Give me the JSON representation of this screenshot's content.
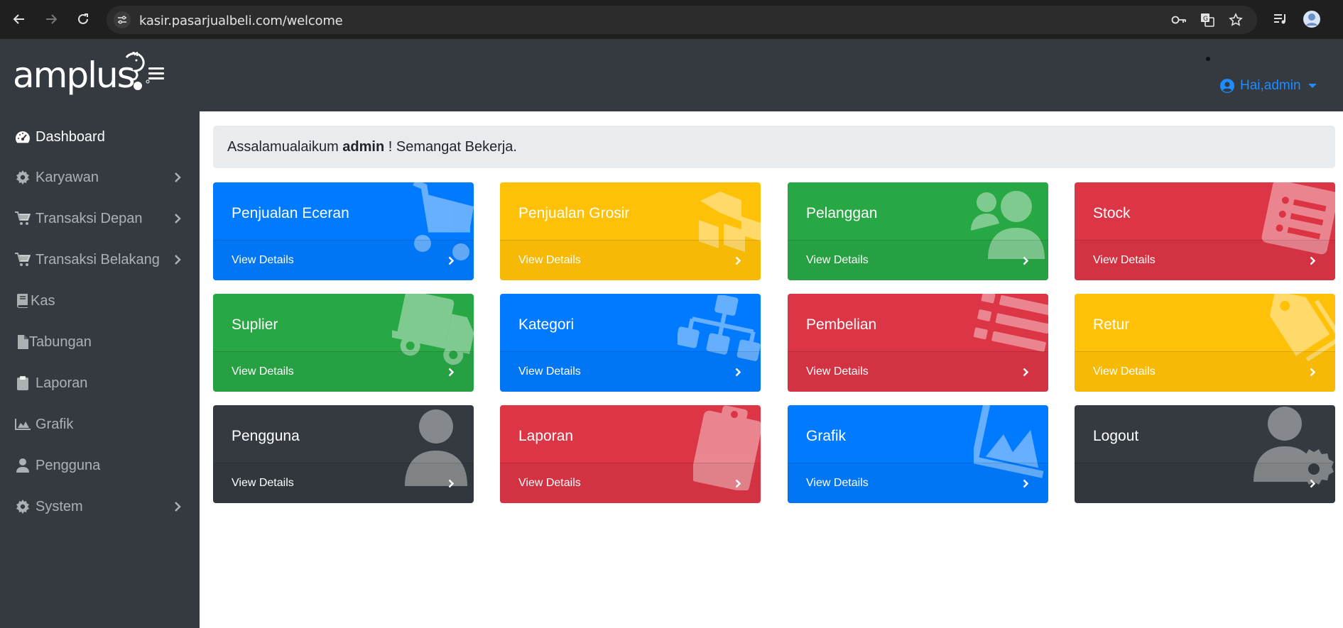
{
  "browser": {
    "url": "kasir.pasarjualbeli.com/welcome",
    "icons": [
      "back-icon",
      "forward-icon",
      "reload-icon",
      "site-settings-icon",
      "password-key-icon",
      "translate-icon",
      "bookmark-star-icon",
      "media-playlist-icon",
      "profile-avatar-icon"
    ]
  },
  "header": {
    "logo_text": "amplus",
    "user_menu_label": "Hai,admin"
  },
  "sidebar": {
    "items": [
      {
        "label": "Dashboard",
        "icon": "tachometer-icon",
        "has_submenu": false,
        "active": true
      },
      {
        "label": "Karyawan",
        "icon": "gear-icon",
        "has_submenu": true,
        "active": false
      },
      {
        "label": "Transaksi Depan",
        "icon": "cart-icon",
        "has_submenu": true,
        "active": false
      },
      {
        "label": "Transaksi Belakang",
        "icon": "cart-icon",
        "has_submenu": true,
        "active": false
      },
      {
        "label": "Kas",
        "icon": "book-icon",
        "has_submenu": false,
        "active": false
      },
      {
        "label": "Tabungan",
        "icon": "file-icon",
        "has_submenu": false,
        "active": false
      },
      {
        "label": "Laporan",
        "icon": "clipboard-icon",
        "has_submenu": false,
        "active": false
      },
      {
        "label": "Grafik",
        "icon": "area-chart-icon",
        "has_submenu": false,
        "active": false
      },
      {
        "label": "Pengguna",
        "icon": "user-icon",
        "has_submenu": false,
        "active": false
      },
      {
        "label": "System",
        "icon": "gear-icon",
        "has_submenu": true,
        "active": false
      }
    ]
  },
  "welcome": {
    "prefix": "Assalamualaikum",
    "user": "admin",
    "suffix": "! Semangat Bekerja."
  },
  "cards": [
    {
      "title": "Penjualan Eceran",
      "link": "View Details",
      "color": "#007bff",
      "icon": "shopping-cart-icon"
    },
    {
      "title": "Penjualan Grosir",
      "link": "View Details",
      "color": "#ffc107",
      "icon": "cubes-icon"
    },
    {
      "title": "Pelanggan",
      "link": "View Details",
      "color": "#28a745",
      "icon": "users-icon"
    },
    {
      "title": "Stock",
      "link": "View Details",
      "color": "#dc3545",
      "icon": "list-alt-icon"
    },
    {
      "title": "Suplier",
      "link": "View Details",
      "color": "#28a745",
      "icon": "truck-icon"
    },
    {
      "title": "Kategori",
      "link": "View Details",
      "color": "#007bff",
      "icon": "sitemap-icon"
    },
    {
      "title": "Pembelian",
      "link": "View Details",
      "color": "#dc3545",
      "icon": "list-icon"
    },
    {
      "title": "Retur",
      "link": "View Details",
      "color": "#ffc107",
      "icon": "tags-icon"
    },
    {
      "title": "Pengguna",
      "link": "View Details",
      "color": "#343a40",
      "icon": "user-icon"
    },
    {
      "title": "Laporan",
      "link": "View Details",
      "color": "#dc3545",
      "icon": "clipboard-icon"
    },
    {
      "title": "Grafik",
      "link": "View Details",
      "color": "#007bff",
      "icon": "area-chart-icon"
    },
    {
      "title": "Logout",
      "link": "",
      "color": "#343a40",
      "icon": "user-cog-icon"
    }
  ],
  "colors": {
    "header_bg": "#343a40",
    "sidebar_bg": "#343a40",
    "accent_link": "#1f8cff",
    "blue": "#007bff",
    "yellow": "#ffc107",
    "green": "#28a745",
    "red": "#dc3545",
    "dark": "#343a40"
  }
}
